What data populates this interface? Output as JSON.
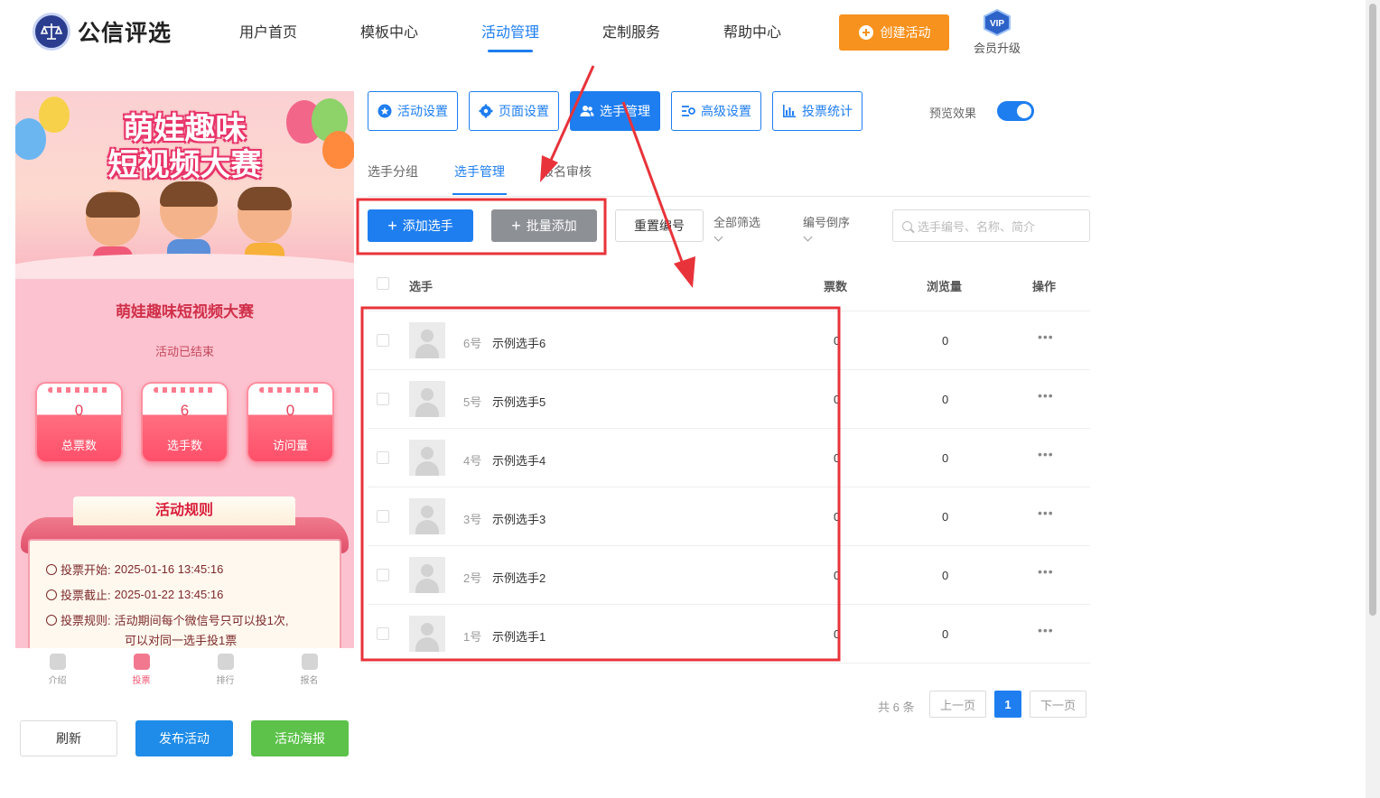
{
  "brand": {
    "name": "公信评选"
  },
  "nav": [
    "用户首页",
    "模板中心",
    "活动管理",
    "定制服务",
    "帮助中心"
  ],
  "create_button": "创建活动",
  "vip": {
    "badge": "VIP",
    "label": "会员升级"
  },
  "preview": {
    "banner_title": [
      "萌娃趣味",
      "短视频大赛"
    ],
    "activity_name": "萌娃趣味短视频大赛",
    "status": "活动已结束",
    "stats": [
      {
        "value": "0",
        "label": "总票数"
      },
      {
        "value": "6",
        "label": "选手数"
      },
      {
        "value": "0",
        "label": "访问量"
      }
    ],
    "rules_title": "活动规则",
    "rules": [
      {
        "label": "投票开始:",
        "value": "2025-01-16 13:45:16"
      },
      {
        "label": "投票截止:",
        "value": "2025-01-22 13:45:16"
      },
      {
        "label": "投票规则:",
        "value": "活动期间每个微信号只可以投1次,",
        "continued": "可以对同一选手投1票"
      }
    ],
    "tabs": [
      "介绍",
      "投票",
      "排行",
      "报名"
    ],
    "active_tab": "投票"
  },
  "bottom_buttons": [
    "刷新",
    "发布活动",
    "活动海报"
  ],
  "toolbar": [
    "活动设置",
    "页面设置",
    "选手管理",
    "高级设置",
    "投票统计"
  ],
  "preview_toggle": {
    "label": "预览效果",
    "on": true
  },
  "subtabs": [
    "选手分组",
    "选手管理",
    "报名审核"
  ],
  "actions": {
    "add": "添加选手",
    "batch_add": "批量添加",
    "reset_number": "重置编号",
    "filter": "全部筛选",
    "sort": "编号倒序",
    "search_placeholder": "选手编号、名称、简介"
  },
  "table": {
    "headers": {
      "player": "选手",
      "votes": "票数",
      "views": "浏览量",
      "ops": "操作"
    },
    "rows": [
      {
        "num": "6号",
        "name": "示例选手6",
        "votes": "0",
        "views": "0"
      },
      {
        "num": "5号",
        "name": "示例选手5",
        "votes": "0",
        "views": "0"
      },
      {
        "num": "4号",
        "name": "示例选手4",
        "votes": "0",
        "views": "0"
      },
      {
        "num": "3号",
        "name": "示例选手3",
        "votes": "0",
        "views": "0"
      },
      {
        "num": "2号",
        "name": "示例选手2",
        "votes": "0",
        "views": "0"
      },
      {
        "num": "1号",
        "name": "示例选手1",
        "votes": "0",
        "views": "0"
      }
    ]
  },
  "pagination": {
    "total": "共 6 条",
    "prev": "上一页",
    "current": "1",
    "next": "下一页"
  },
  "colors": {
    "primary": "#1e7ef0",
    "orange": "#f7921e",
    "annotation": "#e8333a",
    "green": "#5cc24a"
  }
}
